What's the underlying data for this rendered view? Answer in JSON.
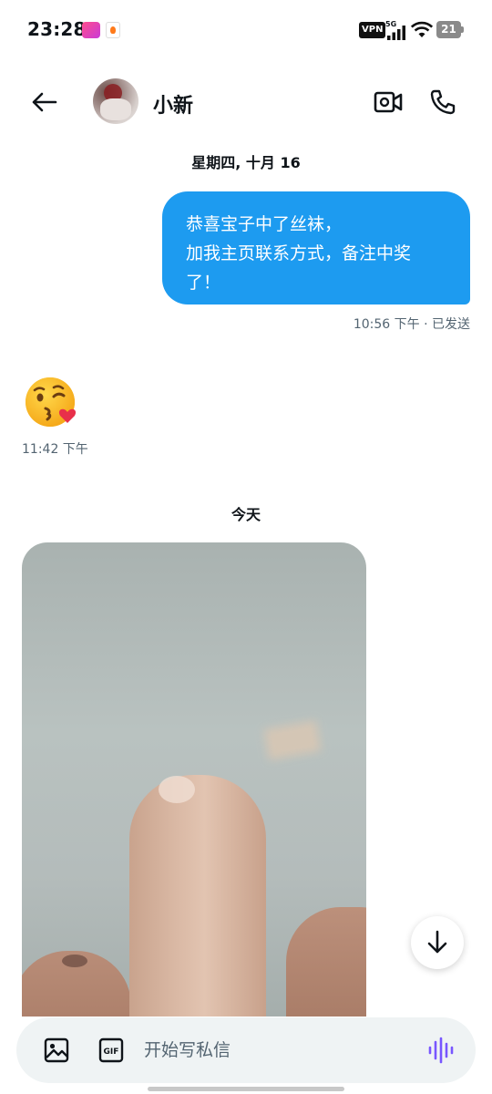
{
  "status_bar": {
    "time": "23:28",
    "vpn": "VPN",
    "network": "5G",
    "battery": "21"
  },
  "header": {
    "contact_name": "小新",
    "icons": [
      "back-arrow-icon",
      "video-camera-icon",
      "phone-icon"
    ]
  },
  "messages": {
    "date_1": "星期四, 十月 16",
    "sent_lines": [
      "恭喜宝子中了丝袜，",
      "加我主页联系方式，备注中奖",
      "了！"
    ],
    "sent_meta": "10:56 下午 · 已发送",
    "received_emoji": "😘",
    "received_meta": "11:42 下午",
    "date_2": "今天"
  },
  "composer": {
    "placeholder": "开始写私信",
    "gif_label": "GIF"
  },
  "colors": {
    "accent": "#1d9bf0",
    "voice_accent": "#7856ff",
    "meta_text": "#536471"
  }
}
